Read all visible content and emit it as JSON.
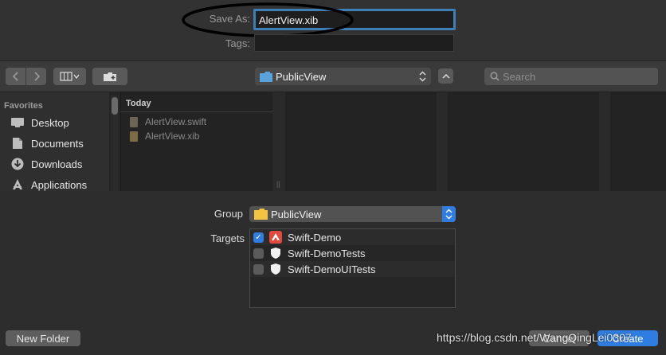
{
  "save_as": {
    "label": "Save As:",
    "value": "AlertView.xib"
  },
  "tags": {
    "label": "Tags:",
    "value": ""
  },
  "toolbar": {
    "location": "PublicView",
    "search_placeholder": "Search"
  },
  "sidebar": {
    "heading": "Favorites",
    "items": [
      {
        "label": "Desktop",
        "icon": "desktop-icon"
      },
      {
        "label": "Documents",
        "icon": "documents-icon"
      },
      {
        "label": "Downloads",
        "icon": "downloads-icon"
      },
      {
        "label": "Applications",
        "icon": "applications-icon"
      }
    ]
  },
  "browser": {
    "column_heading": "Today",
    "files": [
      {
        "name": "AlertView.swift",
        "icon": "swift-file-icon"
      },
      {
        "name": "AlertView.xib",
        "icon": "xib-file-icon"
      }
    ]
  },
  "group": {
    "label": "Group",
    "value": "PublicView"
  },
  "targets": {
    "label": "Targets",
    "items": [
      {
        "name": "Swift-Demo",
        "checked": true,
        "icon": "app-target-icon"
      },
      {
        "name": "Swift-DemoTests",
        "checked": false,
        "icon": "test-target-icon"
      },
      {
        "name": "Swift-DemoUITests",
        "checked": false,
        "icon": "test-target-icon"
      }
    ]
  },
  "buttons": {
    "new_folder": "New Folder",
    "cancel": "Cancel",
    "create": "Create"
  },
  "watermark": "https://blog.csdn.net/WangQingLei0307",
  "colors": {
    "accent": "#2f7de1",
    "focus_ring": "#3f7fb8",
    "annotation": "#000000",
    "folder": "#f5c342"
  }
}
